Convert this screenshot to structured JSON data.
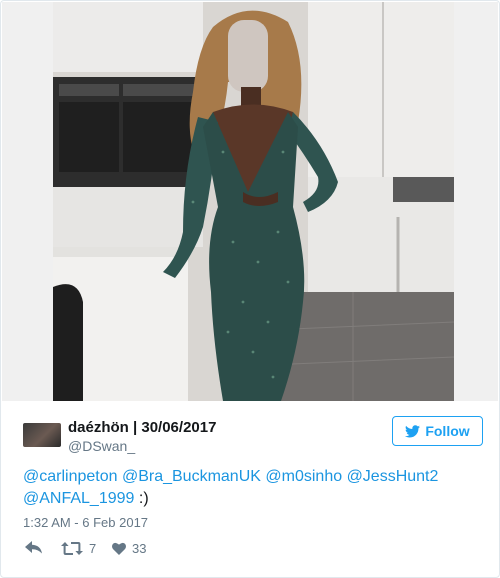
{
  "tweet": {
    "author_name": "daézhön | 30/06/2017",
    "author_handle": "@DSwan_",
    "follow_label": "Follow",
    "text_parts": [
      {
        "text": "@carlinpeton",
        "mention": true
      },
      {
        "text": " ",
        "mention": false
      },
      {
        "text": "@Bra_BuckmanUK",
        "mention": true
      },
      {
        "text": " ",
        "mention": false
      },
      {
        "text": "@m0sinho",
        "mention": true
      },
      {
        "text": " ",
        "mention": false
      },
      {
        "text": "@JessHunt2",
        "mention": true
      },
      {
        "text": " ",
        "mention": false
      },
      {
        "text": "@ANFAL_1999",
        "mention": true
      },
      {
        "text": " :)",
        "mention": false
      }
    ],
    "timestamp": "1:32 AM - 6 Feb 2017",
    "retweet_count": "7",
    "like_count": "33"
  },
  "icons": {
    "follow": "bird-icon",
    "reply": "reply-icon",
    "retweet": "retweet-icon",
    "like": "heart-icon"
  },
  "colors": {
    "accent": "#1da1f2",
    "mention": "#1b95e0",
    "secondary": "#657786",
    "text": "#14171a",
    "border": "#e1e8ed"
  }
}
